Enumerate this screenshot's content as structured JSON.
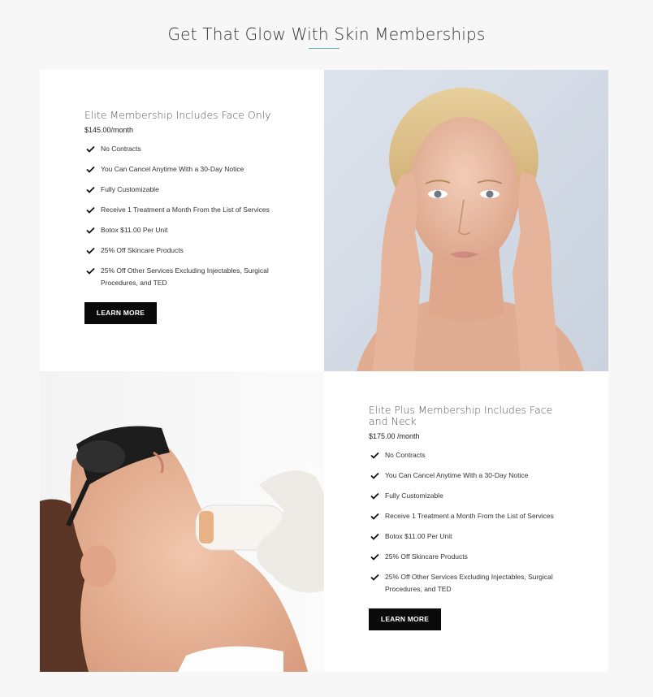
{
  "section": {
    "title": "Get That Glow With Skin Memberships"
  },
  "cards": [
    {
      "title": "Elite Membership Includes Face Only",
      "price": "$145.00/month",
      "features": [
        "No Contracts",
        "You Can Cancel Anytime With a 30-Day Notice",
        "Fully Customizable",
        "Receive 1 Treatment a Month From the List of Services",
        "Botox $11.00 Per Unit",
        "25% Off Skincare Products",
        "25% Off Other Services Excluding Injectables, Surgical Procedures, and TED"
      ],
      "cta_label": "LEARN MORE"
    },
    {
      "title": "Elite Plus Membership Includes Face and Neck",
      "price": "$175.00 /month",
      "features": [
        "No Contracts",
        "You Can Cancel Anytime With a 30-Day Notice",
        "Fully Customizable",
        "Receive 1 Treatment a Month From the List of Services",
        "Botox $11.00 Per Unit",
        "25% Off Skincare Products",
        "25% Off Other Services Excluding Injectables, Surgical Procedures, and TED"
      ],
      "cta_label": "LEARN MORE"
    }
  ],
  "colors": {
    "accent_underline": "#5aa8ad",
    "button_bg": "#0a0a0a",
    "page_bg": "#f7f7f7"
  },
  "icons": {
    "feature_bullet": "check-icon"
  }
}
